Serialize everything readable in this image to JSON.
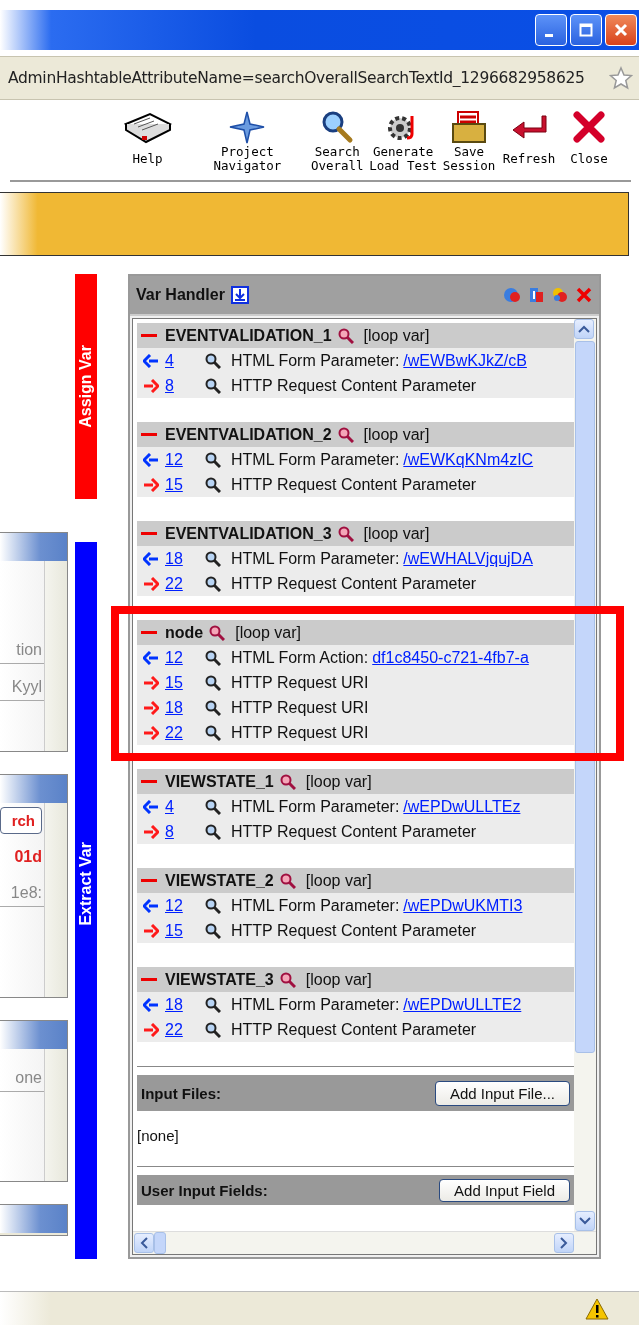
{
  "window": {
    "address": "AdminHashtableAttributeName=searchOverallSearchTextId_1296682958625"
  },
  "toolbar": [
    {
      "kind": "help",
      "lines": [
        "Help"
      ]
    },
    {
      "kind": "navigator",
      "lines": [
        "Project",
        "Navigator"
      ]
    },
    {
      "kind": "search",
      "lines": [
        "Search",
        "Overall"
      ]
    },
    {
      "kind": "generate",
      "lines": [
        "Generate",
        "Load Test"
      ]
    },
    {
      "kind": "save",
      "lines": [
        "Save",
        "Session"
      ]
    },
    {
      "kind": "refresh",
      "lines": [
        "Refresh"
      ]
    },
    {
      "kind": "close",
      "lines": [
        "Close"
      ]
    }
  ],
  "left_panels": [
    {
      "texts": [
        "tion",
        "Kyyl"
      ]
    },
    {
      "button": "rch",
      "texts": [
        "01d",
        "1e8:"
      ]
    },
    {
      "texts": [
        "one"
      ]
    }
  ],
  "side_tabs": [
    {
      "label": "Assign Var",
      "color": "#ff0000"
    },
    {
      "label": "Extract Var",
      "color": "#0000ff"
    }
  ],
  "var_handler": {
    "title": "Var Handler",
    "vars": [
      {
        "name": "EVENTVALIDATION_1",
        "tag": "[loop var]",
        "highlighted": false,
        "refs": [
          {
            "kind": "in",
            "line": "4",
            "text": "HTML Form Parameter:",
            "value": "/wEWBwKJkZ/cB"
          },
          {
            "kind": "out",
            "line": "8",
            "text": "HTTP Request Content Parameter"
          }
        ]
      },
      {
        "name": "EVENTVALIDATION_2",
        "tag": "[loop var]",
        "highlighted": false,
        "refs": [
          {
            "kind": "in",
            "line": "12",
            "text": "HTML Form Parameter:",
            "value": "/wEWKqKNm4zIC"
          },
          {
            "kind": "out",
            "line": "15",
            "text": "HTTP Request Content Parameter"
          }
        ]
      },
      {
        "name": "EVENTVALIDATION_3",
        "tag": "[loop var]",
        "highlighted": false,
        "refs": [
          {
            "kind": "in",
            "line": "18",
            "text": "HTML Form Parameter:",
            "value": "/wEWHALVjqujDA"
          },
          {
            "kind": "out",
            "line": "22",
            "text": "HTTP Request Content Parameter"
          }
        ]
      },
      {
        "name": "node",
        "tag": "[loop var]",
        "highlighted": true,
        "refs": [
          {
            "kind": "in",
            "line": "12",
            "text": "HTML Form Action:",
            "value": "df1c8450-c721-4fb7-a"
          },
          {
            "kind": "out",
            "line": "15",
            "text": "HTTP Request URI"
          },
          {
            "kind": "out",
            "line": "18",
            "text": "HTTP Request URI"
          },
          {
            "kind": "out",
            "line": "22",
            "text": "HTTP Request URI"
          }
        ]
      },
      {
        "name": "VIEWSTATE_1",
        "tag": "[loop var]",
        "highlighted": false,
        "refs": [
          {
            "kind": "in",
            "line": "4",
            "text": "HTML Form Parameter:",
            "value": "/wEPDwULLTEz"
          },
          {
            "kind": "out",
            "line": "8",
            "text": "HTTP Request Content Parameter"
          }
        ]
      },
      {
        "name": "VIEWSTATE_2",
        "tag": "[loop var]",
        "highlighted": false,
        "refs": [
          {
            "kind": "in",
            "line": "12",
            "text": "HTML Form Parameter:",
            "value": "/wEPDwUKMTI3"
          },
          {
            "kind": "out",
            "line": "15",
            "text": "HTTP Request Content Parameter"
          }
        ]
      },
      {
        "name": "VIEWSTATE_3",
        "tag": "[loop var]",
        "highlighted": false,
        "refs": [
          {
            "kind": "in",
            "line": "18",
            "text": "HTML Form Parameter:",
            "value": "/wEPDwULLTE2"
          },
          {
            "kind": "out",
            "line": "22",
            "text": "HTTP Request Content Parameter"
          }
        ]
      }
    ],
    "input_files": {
      "label": "Input Files:",
      "button": "Add Input File...",
      "value": "[none]"
    },
    "user_input_fields": {
      "label": "User Input Fields:",
      "button": "Add Input Field"
    }
  }
}
